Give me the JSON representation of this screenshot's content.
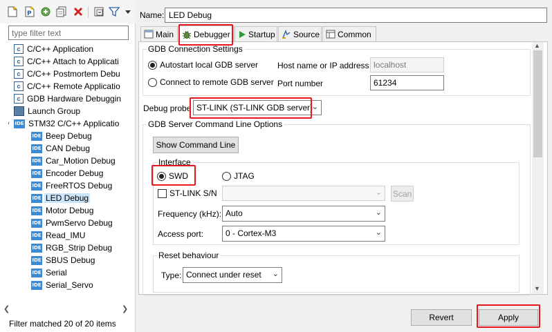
{
  "left": {
    "toolbar": [
      {
        "name": "new-config-icon"
      },
      {
        "name": "new-prototype-icon"
      },
      {
        "name": "export-icon"
      },
      {
        "name": "duplicate-icon"
      },
      {
        "name": "delete-icon"
      },
      {
        "name": "collapse-all-icon"
      },
      {
        "name": "filter-icon"
      },
      {
        "name": "view-menu-icon"
      }
    ],
    "filter_placeholder": "type filter text",
    "tree": [
      {
        "label": "C/C++ Application",
        "icon": "c-icon"
      },
      {
        "label": "C/C++ Attach to Applicati",
        "icon": "c-icon"
      },
      {
        "label": "C/C++ Postmortem Debu",
        "icon": "c-icon"
      },
      {
        "label": "C/C++ Remote Applicatio",
        "icon": "c-icon"
      },
      {
        "label": "GDB Hardware Debuggin",
        "icon": "c-icon"
      },
      {
        "label": "Launch Group",
        "icon": "launch-group-icon"
      },
      {
        "label": "STM32 C/C++ Applicatio",
        "icon": "ide-icon",
        "expanded": true
      },
      {
        "label": "Beep Debug",
        "icon": "ide-icon"
      },
      {
        "label": "CAN Debug",
        "icon": "ide-icon"
      },
      {
        "label": "Car_Motion Debug",
        "icon": "ide-icon"
      },
      {
        "label": "Encoder Debug",
        "icon": "ide-icon"
      },
      {
        "label": "FreeRTOS Debug",
        "icon": "ide-icon"
      },
      {
        "label": "LED Debug",
        "icon": "ide-icon",
        "selected": true
      },
      {
        "label": "Motor Debug",
        "icon": "ide-icon"
      },
      {
        "label": "PwmServo Debug",
        "icon": "ide-icon"
      },
      {
        "label": "Read_IMU",
        "icon": "ide-icon"
      },
      {
        "label": "RGB_Strip Debug",
        "icon": "ide-icon"
      },
      {
        "label": "SBUS Debug",
        "icon": "ide-icon"
      },
      {
        "label": "Serial",
        "icon": "ide-icon"
      },
      {
        "label": "Serial_Servo",
        "icon": "ide-icon"
      }
    ],
    "status": "Filter matched 20 of 20 items",
    "ide_badge": "IDE",
    "c_badge": "c"
  },
  "right": {
    "name_label": "Name:",
    "name_value": "LED Debug",
    "tabs": [
      {
        "label": "Main",
        "icon": "main-tab-icon"
      },
      {
        "label": "Debugger",
        "icon": "debugger-bug-icon",
        "active": true
      },
      {
        "label": "Startup",
        "icon": "startup-play-icon"
      },
      {
        "label": "Source",
        "icon": "source-icon"
      },
      {
        "label": "Common",
        "icon": "common-icon"
      }
    ],
    "gdb_connection": {
      "title": "GDB Connection Settings",
      "autostart_label": "Autostart local GDB server",
      "remote_label": "Connect to remote GDB server",
      "selected": "autostart",
      "host_label": "Host name or IP address",
      "host_value": "localhost",
      "port_label": "Port number",
      "port_value": "61234"
    },
    "debug_probe": {
      "label": "Debug probe",
      "value": "ST-LINK (ST-LINK GDB server)"
    },
    "gdb_server": {
      "title": "GDB Server Command Line Options",
      "show_cmd_label": "Show Command Line",
      "interface": {
        "title": "Interface",
        "swd_label": "SWD",
        "jtag_label": "JTAG",
        "selected": "SWD"
      },
      "stlink_sn_label": "ST-LINK S/N",
      "scan_label": "Scan",
      "frequency_label": "Frequency (kHz):",
      "frequency_value": "Auto",
      "access_port_label": "Access port:",
      "access_port_value": "0 - Cortex-M3"
    },
    "reset": {
      "title": "Reset behaviour",
      "type_label": "Type:",
      "type_value": "Connect under reset"
    },
    "buttons": {
      "revert": "Revert",
      "apply": "Apply"
    }
  },
  "colors": {
    "highlight": "#e8141e",
    "selection": "#cce4f7",
    "ide_badge": "#3b8bd4"
  }
}
